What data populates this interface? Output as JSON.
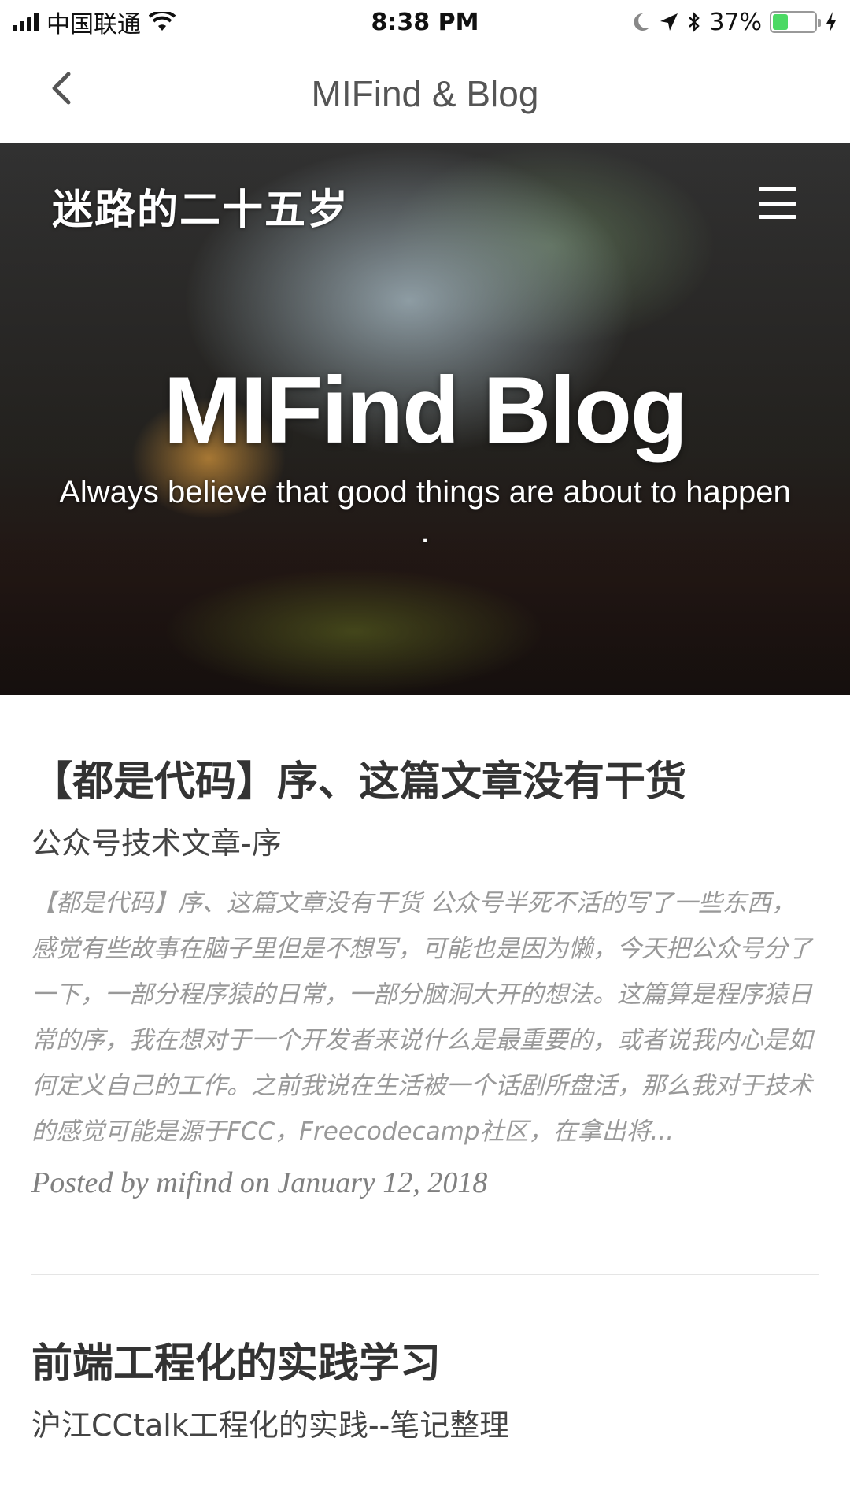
{
  "status_bar": {
    "carrier": "中国联通",
    "time": "8:38 PM",
    "battery_percent": "37%",
    "battery_level": 0.37,
    "icons": [
      "signal-icon",
      "wifi-icon",
      "moon-icon",
      "location-icon",
      "bluetooth-icon",
      "battery-icon",
      "charging-icon"
    ]
  },
  "nav": {
    "title": "MIFind & Blog"
  },
  "hero": {
    "site_title": "迷路的二十五岁",
    "heading": "MIFind Blog",
    "subheading": "Always believe that good things are about to happen ."
  },
  "posts": [
    {
      "title": "【都是代码】序、这篇文章没有干货",
      "subtitle": "公众号技术文章-序",
      "excerpt": "【都是代码】序、这篇文章没有干货 公众号半死不活的写了一些东西，感觉有些故事在脑子里但是不想写，可能也是因为懒，今天把公众号分了一下，一部分程序猿的日常，一部分脑洞大开的想法。这篇算是程序猿日常的序，我在想对于一个开发者来说什么是最重要的，或者说我内心是如何定义自己的工作。之前我说在生活被一个话剧所盘活，那么我对于技术的感觉可能是源于FCC，Freecodecamp社区，在拿出将...",
      "meta": "Posted by mifind on January 12, 2018"
    },
    {
      "title": "前端工程化的实践学习",
      "subtitle": "沪江CCtalk工程化的实践--笔记整理"
    }
  ]
}
